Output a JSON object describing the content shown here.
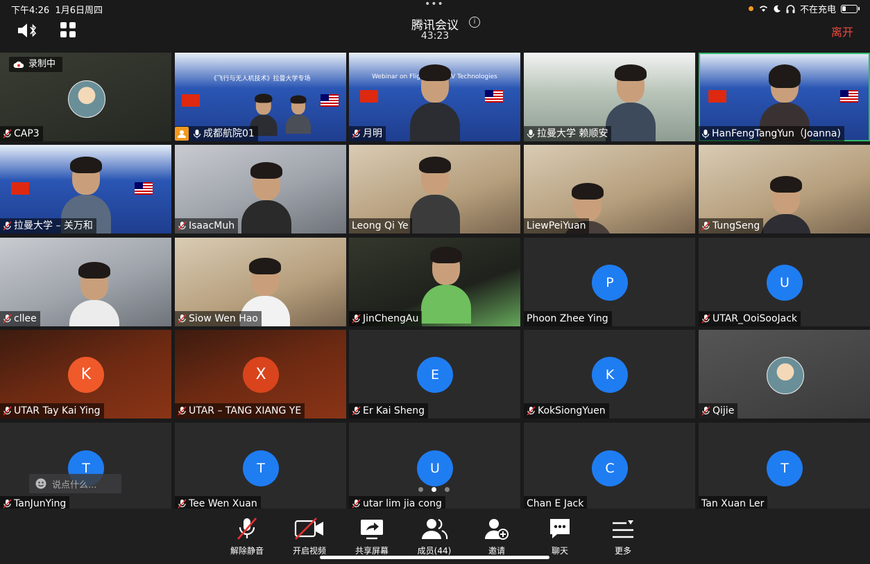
{
  "status": {
    "time": "下午4:26",
    "date": "1月6日周四",
    "charging": "不在充电"
  },
  "header": {
    "title": "腾讯会议",
    "duration": "43:23",
    "leave": "离开"
  },
  "recording": "录制中",
  "banner_text": "《飞行与无人机技术》拉曼大学专场",
  "banner_text_en": "Webinar on Flight and UAV Technologies",
  "tiles": [
    {
      "name": "CAP3"
    },
    {
      "name": "成都航院01"
    },
    {
      "name": "月明"
    },
    {
      "name": "拉曼大学 赖顺安"
    },
    {
      "name": "HanFengTangYun（Joanna)"
    },
    {
      "name": "拉曼大学 – 关万和"
    },
    {
      "name": "IsaacMuh"
    },
    {
      "name": "Leong Qi Ye"
    },
    {
      "name": "LiewPeiYuan"
    },
    {
      "name": "TungSeng"
    },
    {
      "name": "cllee"
    },
    {
      "name": "Siow Wen Hao"
    },
    {
      "name": "JinChengAu"
    },
    {
      "name": "Phoon Zhee Ying",
      "initial": "P"
    },
    {
      "name": "UTAR_OoiSooJack",
      "initial": "U"
    },
    {
      "name": "UTAR Tay Kai Ying",
      "initial": "K"
    },
    {
      "name": "UTAR – TANG XIANG YE",
      "initial": "X"
    },
    {
      "name": "Er Kai Sheng",
      "initial": "E"
    },
    {
      "name": "KokSiongYuen",
      "initial": "K"
    },
    {
      "name": "Qijie"
    },
    {
      "name": "TanJunYing",
      "initial": "T"
    },
    {
      "name": "Tee Wen Xuan",
      "initial": "T"
    },
    {
      "name": "utar lim jia cong",
      "initial": "U"
    },
    {
      "name": "Chan E Jack",
      "initial": "C"
    },
    {
      "name": "Tan Xuan Ler",
      "initial": "T"
    }
  ],
  "chat": {
    "placeholder": "说点什么..."
  },
  "toolbar": {
    "unmute": "解除静音",
    "video": "开启视频",
    "share": "共享屏幕",
    "members": "成员(44)",
    "invite": "邀请",
    "chat": "聊天",
    "more": "更多"
  },
  "colors": {
    "accent": "#1f7df2",
    "leave": "#f0483c",
    "active_border": "#2fb86a"
  }
}
